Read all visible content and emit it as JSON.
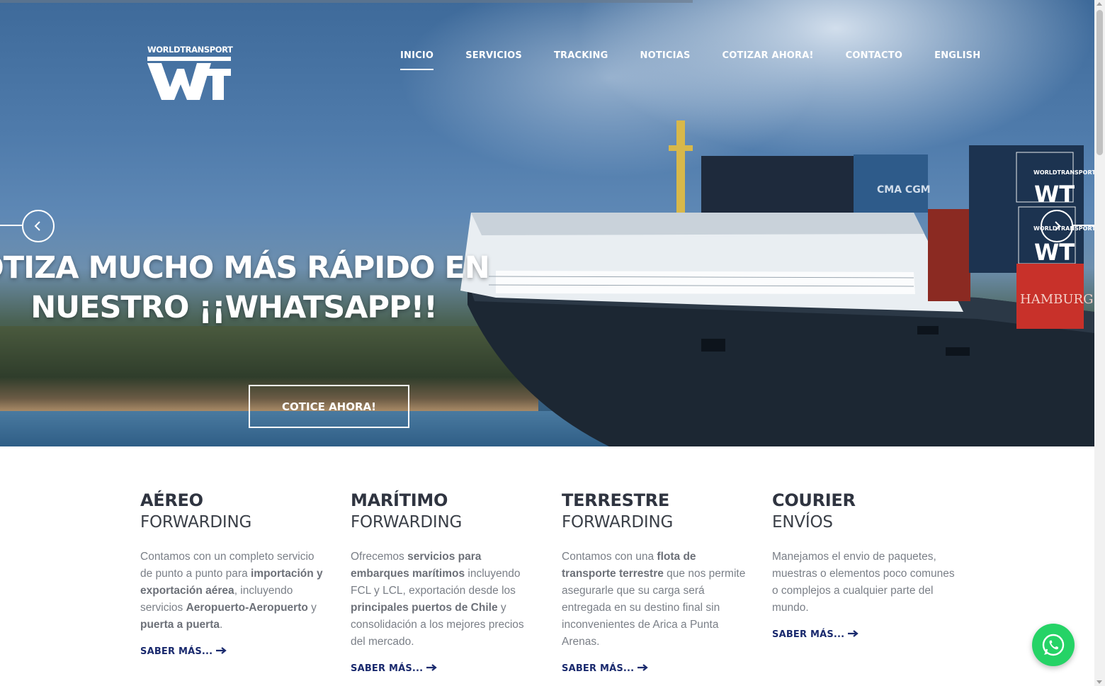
{
  "brand": {
    "logo_text": "WORLDTRANSPORT",
    "logo_mark": "WT"
  },
  "nav": [
    {
      "label": "INICIO",
      "active": true
    },
    {
      "label": "SERVICIOS",
      "active": false
    },
    {
      "label": "TRACKING",
      "active": false
    },
    {
      "label": "NOTICIAS",
      "active": false
    },
    {
      "label": "COTIZAR AHORA!",
      "active": false
    },
    {
      "label": "CONTACTO",
      "active": false
    },
    {
      "label": "ENGLISH",
      "active": false
    }
  ],
  "hero": {
    "headline_line1": "OTIZA MUCHO MÁS RÁPIDO EN",
    "headline_line2": "NUESTRO ¡¡WHATSAPP!!",
    "cta_label": "COTICE AHORA!",
    "prev_icon": "chevron-left-icon",
    "next_icon": "chevron-right-icon"
  },
  "services": [
    {
      "title": "AÉREO",
      "subtitle": "FORWARDING",
      "desc_parts": [
        {
          "t": "Contamos con un completo servicio de punto a punto para "
        },
        {
          "t": "importación y exportación aérea",
          "b": true
        },
        {
          "t": ", incluyendo servicios "
        },
        {
          "t": "Aeropuerto-Aeropuerto",
          "b": true
        },
        {
          "t": " y "
        },
        {
          "t": "puerta a puerta",
          "b": true
        },
        {
          "t": "."
        }
      ],
      "link": "SABER MÁS..."
    },
    {
      "title": "MARÍTIMO",
      "subtitle": "FORWARDING",
      "desc_parts": [
        {
          "t": "Ofrecemos "
        },
        {
          "t": "servicios para embarques marítimos",
          "b": true
        },
        {
          "t": " incluyendo FCL y LCL, exportación desde los "
        },
        {
          "t": "principales puertos de Chile",
          "b": true
        },
        {
          "t": " y consolidación a los mejores precios del mercado."
        }
      ],
      "link": "SABER MÁS..."
    },
    {
      "title": "TERRESTRE",
      "subtitle": "FORWARDING",
      "desc_parts": [
        {
          "t": "Contamos con una "
        },
        {
          "t": "flota de transporte terrestre",
          "b": true
        },
        {
          "t": " que nos permite asegurarle que su carga será entregada en su destino final sin inconvenientes de Arica a Punta Arenas."
        }
      ],
      "link": "SABER MÁS..."
    },
    {
      "title": "COURIER",
      "subtitle": "ENVÍOS",
      "desc_parts": [
        {
          "t": "Manejamos el envio de paquetes, muestras o elementos poco comunes o complejos a cualquier parte del mundo."
        }
      ],
      "link": "SABER MÁS..."
    }
  ],
  "ship_labels": {
    "container_brand": "CMA CGM",
    "container_brand2": "HAMBURG SÜD",
    "container_logo": "WORLDTRANSPORT"
  },
  "colors": {
    "accent": "#1a2a6e",
    "whatsapp": "#25d366",
    "heading": "#2f3440",
    "body_text": "#7a7f87"
  },
  "whatsapp_icon": "whatsapp-icon"
}
